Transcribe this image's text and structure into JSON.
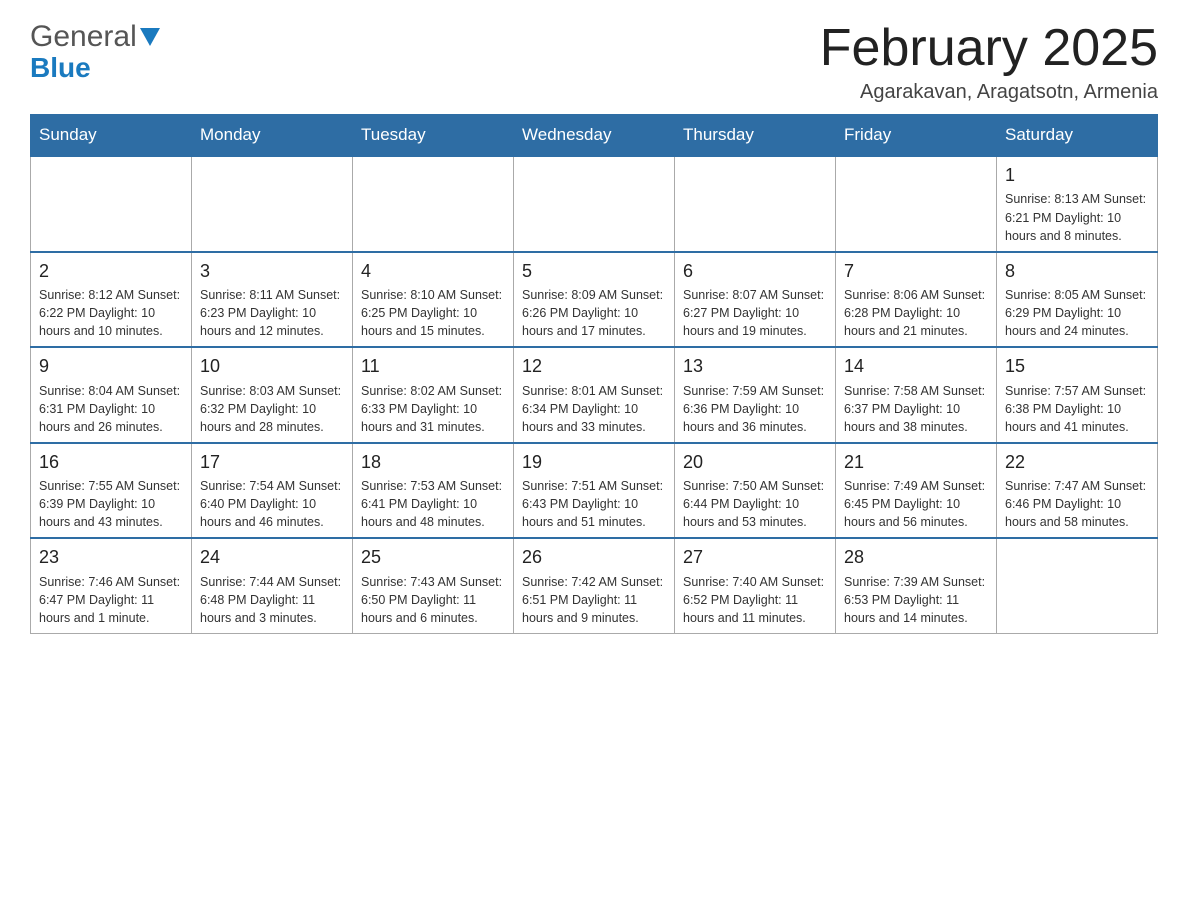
{
  "header": {
    "logo_general": "General",
    "logo_blue": "Blue",
    "month_title": "February 2025",
    "location": "Agarakavan, Aragatsotn, Armenia"
  },
  "weekdays": [
    "Sunday",
    "Monday",
    "Tuesday",
    "Wednesday",
    "Thursday",
    "Friday",
    "Saturday"
  ],
  "weeks": [
    [
      {
        "day": "",
        "info": ""
      },
      {
        "day": "",
        "info": ""
      },
      {
        "day": "",
        "info": ""
      },
      {
        "day": "",
        "info": ""
      },
      {
        "day": "",
        "info": ""
      },
      {
        "day": "",
        "info": ""
      },
      {
        "day": "1",
        "info": "Sunrise: 8:13 AM\nSunset: 6:21 PM\nDaylight: 10 hours and 8 minutes."
      }
    ],
    [
      {
        "day": "2",
        "info": "Sunrise: 8:12 AM\nSunset: 6:22 PM\nDaylight: 10 hours and 10 minutes."
      },
      {
        "day": "3",
        "info": "Sunrise: 8:11 AM\nSunset: 6:23 PM\nDaylight: 10 hours and 12 minutes."
      },
      {
        "day": "4",
        "info": "Sunrise: 8:10 AM\nSunset: 6:25 PM\nDaylight: 10 hours and 15 minutes."
      },
      {
        "day": "5",
        "info": "Sunrise: 8:09 AM\nSunset: 6:26 PM\nDaylight: 10 hours and 17 minutes."
      },
      {
        "day": "6",
        "info": "Sunrise: 8:07 AM\nSunset: 6:27 PM\nDaylight: 10 hours and 19 minutes."
      },
      {
        "day": "7",
        "info": "Sunrise: 8:06 AM\nSunset: 6:28 PM\nDaylight: 10 hours and 21 minutes."
      },
      {
        "day": "8",
        "info": "Sunrise: 8:05 AM\nSunset: 6:29 PM\nDaylight: 10 hours and 24 minutes."
      }
    ],
    [
      {
        "day": "9",
        "info": "Sunrise: 8:04 AM\nSunset: 6:31 PM\nDaylight: 10 hours and 26 minutes."
      },
      {
        "day": "10",
        "info": "Sunrise: 8:03 AM\nSunset: 6:32 PM\nDaylight: 10 hours and 28 minutes."
      },
      {
        "day": "11",
        "info": "Sunrise: 8:02 AM\nSunset: 6:33 PM\nDaylight: 10 hours and 31 minutes."
      },
      {
        "day": "12",
        "info": "Sunrise: 8:01 AM\nSunset: 6:34 PM\nDaylight: 10 hours and 33 minutes."
      },
      {
        "day": "13",
        "info": "Sunrise: 7:59 AM\nSunset: 6:36 PM\nDaylight: 10 hours and 36 minutes."
      },
      {
        "day": "14",
        "info": "Sunrise: 7:58 AM\nSunset: 6:37 PM\nDaylight: 10 hours and 38 minutes."
      },
      {
        "day": "15",
        "info": "Sunrise: 7:57 AM\nSunset: 6:38 PM\nDaylight: 10 hours and 41 minutes."
      }
    ],
    [
      {
        "day": "16",
        "info": "Sunrise: 7:55 AM\nSunset: 6:39 PM\nDaylight: 10 hours and 43 minutes."
      },
      {
        "day": "17",
        "info": "Sunrise: 7:54 AM\nSunset: 6:40 PM\nDaylight: 10 hours and 46 minutes."
      },
      {
        "day": "18",
        "info": "Sunrise: 7:53 AM\nSunset: 6:41 PM\nDaylight: 10 hours and 48 minutes."
      },
      {
        "day": "19",
        "info": "Sunrise: 7:51 AM\nSunset: 6:43 PM\nDaylight: 10 hours and 51 minutes."
      },
      {
        "day": "20",
        "info": "Sunrise: 7:50 AM\nSunset: 6:44 PM\nDaylight: 10 hours and 53 minutes."
      },
      {
        "day": "21",
        "info": "Sunrise: 7:49 AM\nSunset: 6:45 PM\nDaylight: 10 hours and 56 minutes."
      },
      {
        "day": "22",
        "info": "Sunrise: 7:47 AM\nSunset: 6:46 PM\nDaylight: 10 hours and 58 minutes."
      }
    ],
    [
      {
        "day": "23",
        "info": "Sunrise: 7:46 AM\nSunset: 6:47 PM\nDaylight: 11 hours and 1 minute."
      },
      {
        "day": "24",
        "info": "Sunrise: 7:44 AM\nSunset: 6:48 PM\nDaylight: 11 hours and 3 minutes."
      },
      {
        "day": "25",
        "info": "Sunrise: 7:43 AM\nSunset: 6:50 PM\nDaylight: 11 hours and 6 minutes."
      },
      {
        "day": "26",
        "info": "Sunrise: 7:42 AM\nSunset: 6:51 PM\nDaylight: 11 hours and 9 minutes."
      },
      {
        "day": "27",
        "info": "Sunrise: 7:40 AM\nSunset: 6:52 PM\nDaylight: 11 hours and 11 minutes."
      },
      {
        "day": "28",
        "info": "Sunrise: 7:39 AM\nSunset: 6:53 PM\nDaylight: 11 hours and 14 minutes."
      },
      {
        "day": "",
        "info": ""
      }
    ]
  ]
}
